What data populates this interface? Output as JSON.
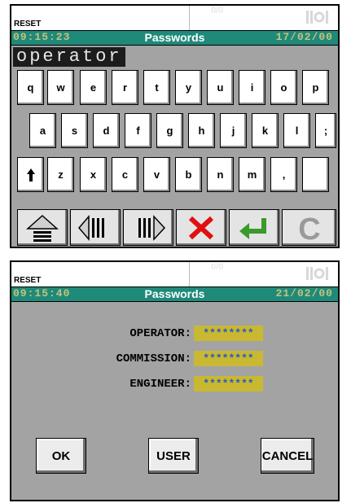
{
  "keyboard_screen": {
    "header": {
      "reset": "RESET",
      "io": "0/0"
    },
    "status": {
      "time": "09:15:23",
      "title": "Passwords",
      "date": "17/02/00"
    },
    "entry_value": "operator",
    "rows": [
      [
        "q",
        "w",
        "e",
        "r",
        "t",
        "y",
        "u",
        "i",
        "o",
        "p"
      ],
      [
        "a",
        "s",
        "d",
        "f",
        "g",
        "h",
        "j",
        "k",
        "l",
        ";"
      ],
      [
        "",
        "z",
        "x",
        "c",
        "v",
        "b",
        "n",
        "m",
        ",",
        ""
      ]
    ],
    "function_keys": [
      "shift-icon",
      "cursor-left-icon",
      "cursor-right-icon",
      "delete-icon",
      "enter-icon",
      "clear-icon"
    ]
  },
  "password_screen": {
    "header": {
      "reset": "RESET",
      "io": "0/0"
    },
    "status": {
      "time": "09:15:40",
      "title": "Passwords",
      "date": "21/02/00"
    },
    "fields": [
      {
        "label": "OPERATOR:",
        "value": "********"
      },
      {
        "label": "COMMISSION:",
        "value": "********"
      },
      {
        "label": "ENGINEER:",
        "value": "********"
      }
    ],
    "buttons": {
      "ok": "OK",
      "user": "USER",
      "cancel": "CANCEL"
    }
  },
  "colors": {
    "status_bar": "#1f8a7a",
    "panel_bg": "#a3a3a3",
    "password_field": "#c8b832",
    "delete": "#e01010",
    "enter": "#3a9a2a"
  }
}
